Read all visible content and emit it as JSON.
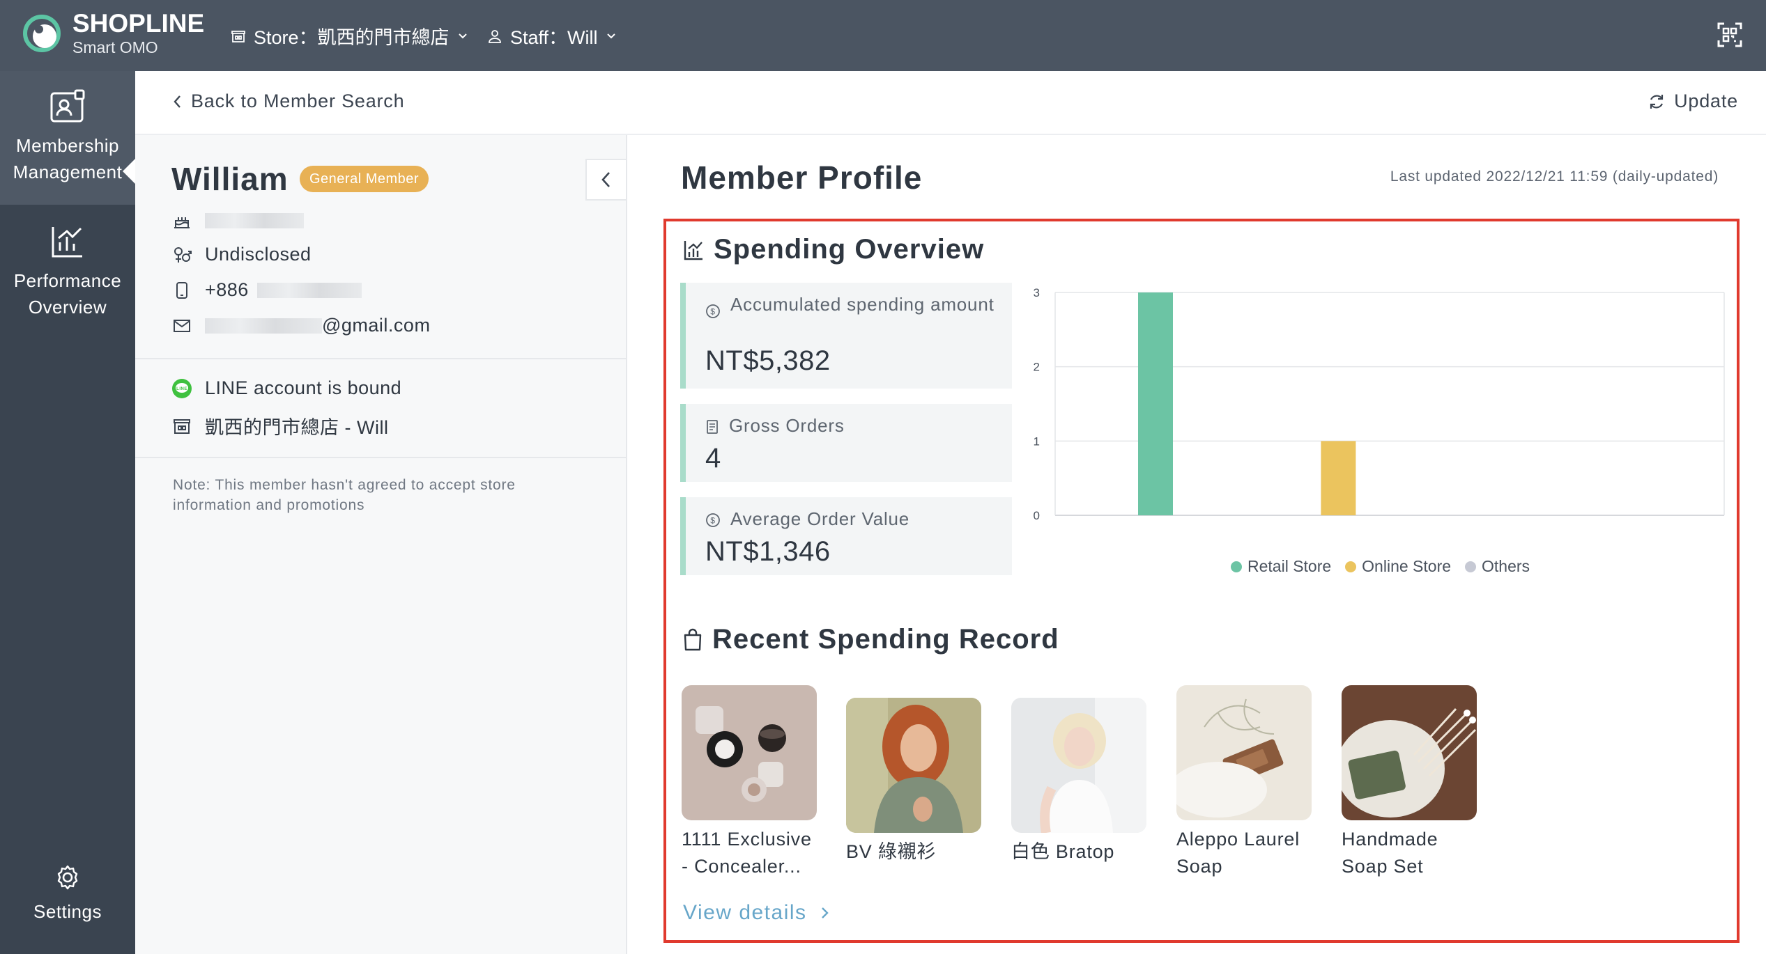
{
  "header": {
    "brand_name": "SHOPLINE",
    "brand_sub": "Smart OMO",
    "store_label": "Store：凱西的門市總店",
    "staff_label": "Staff：Will"
  },
  "sidebar": {
    "items": [
      {
        "line1": "Membership",
        "line2": "Management"
      },
      {
        "line1": "Performance",
        "line2": "Overview"
      },
      {
        "line1": "Settings"
      }
    ]
  },
  "subheader": {
    "back_label": "Back to Member Search",
    "update_label": "Update"
  },
  "member": {
    "name": "William",
    "tier": "General Member",
    "gender": "Undisclosed",
    "phone_prefix": "+886",
    "email_suffix": "@gmail.com",
    "line_status": "LINE account is bound",
    "store_staff": "凱西的門市總店 - Will",
    "note": "Note: This member hasn't agreed to accept store information and promotions"
  },
  "profile": {
    "title": "Member Profile",
    "last_updated": "Last updated 2022/12/21 11:59 (daily-updated)"
  },
  "spending_overview": {
    "title": "Spending Overview",
    "stats": [
      {
        "label": "Accumulated spending amount",
        "value": "NT$5,382"
      },
      {
        "label": "Gross Orders",
        "value": "4"
      },
      {
        "label": "Average Order Value",
        "value": "NT$1,346"
      }
    ]
  },
  "chart_data": {
    "type": "bar",
    "categories": [
      "Retail Store",
      "Online Store",
      "Others"
    ],
    "values": [
      3,
      1,
      0
    ],
    "colors": [
      "#6cc4a4",
      "#ebc45e",
      "#c6c9d4"
    ],
    "yticks": [
      "0",
      "1",
      "2",
      "3"
    ],
    "ylim": [
      0,
      3
    ],
    "grid": true,
    "legend_position": "bottom"
  },
  "recent_spending": {
    "title": "Recent Spending Record",
    "products": [
      {
        "name": "1111 Exclusive - Concealer..."
      },
      {
        "name": "BV 綠襯衫"
      },
      {
        "name": "白色 Bratop"
      },
      {
        "name": "Aleppo Laurel Soap"
      },
      {
        "name": "Handmade Soap Set"
      }
    ],
    "view_details_label": "View details"
  }
}
